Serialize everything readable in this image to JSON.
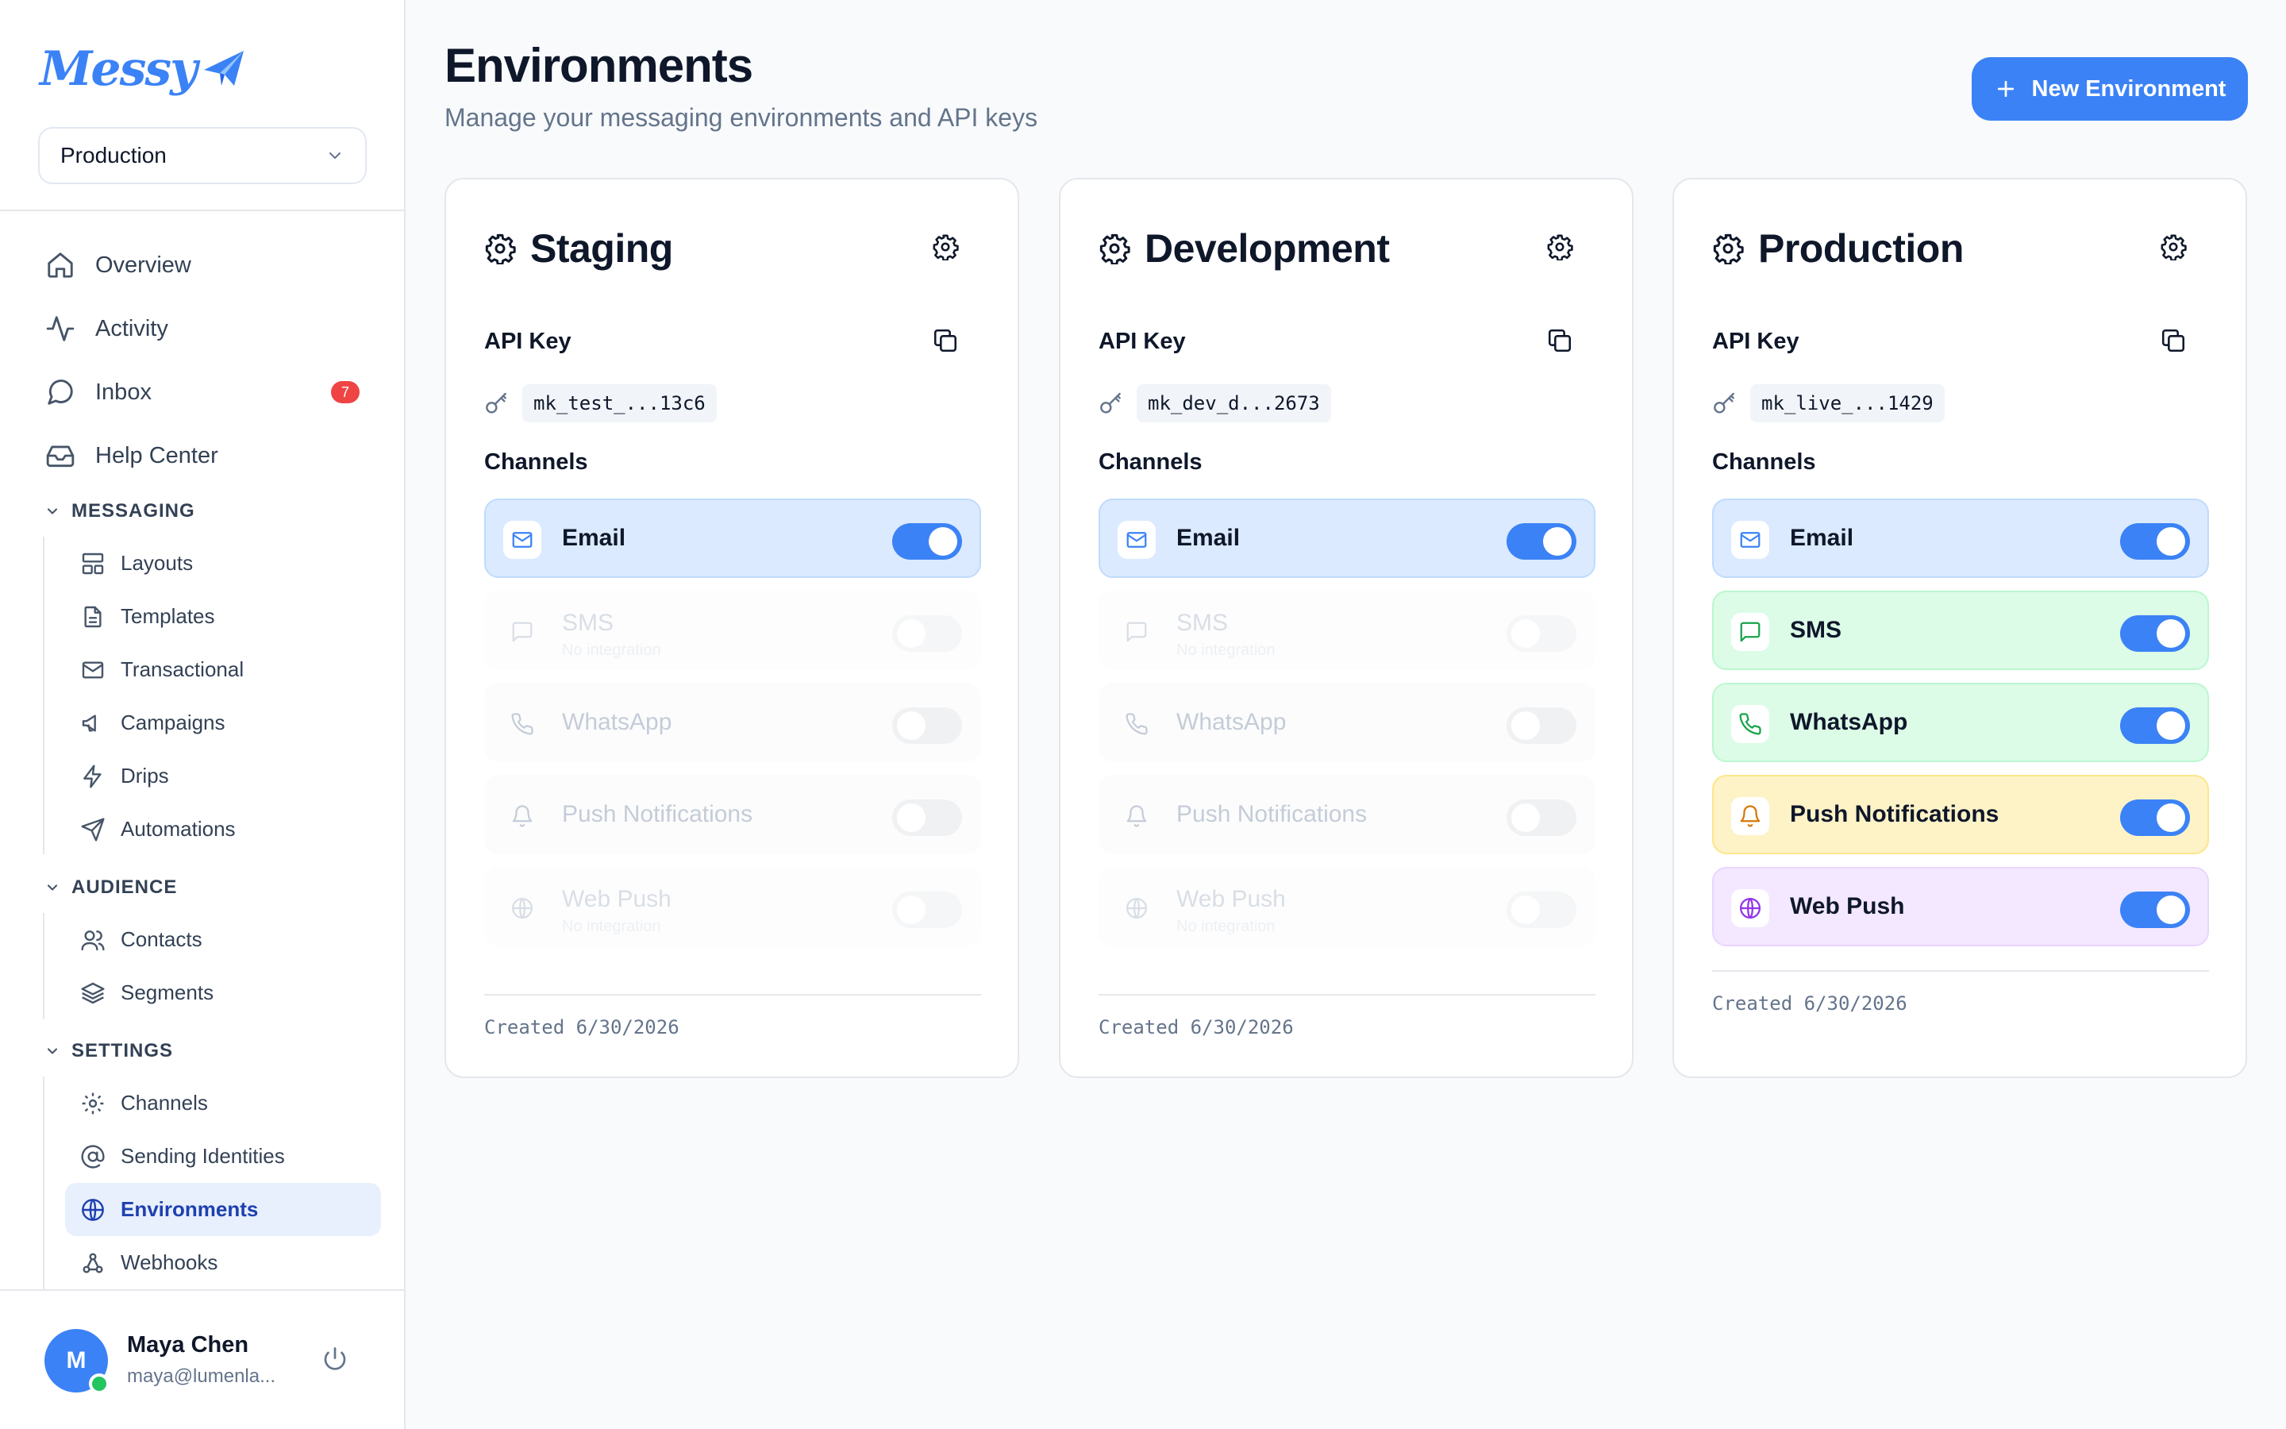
{
  "app": {
    "logo_text": "Messy",
    "brand_color": "#3b82f6"
  },
  "env_select": {
    "value": "Production"
  },
  "nav": {
    "main": [
      {
        "label": "Overview",
        "icon": "home-icon"
      },
      {
        "label": "Activity",
        "icon": "activity-icon"
      },
      {
        "label": "Inbox",
        "icon": "message-icon",
        "badge": "7"
      },
      {
        "label": "Help Center",
        "icon": "inbox-tray-icon"
      }
    ],
    "messaging": {
      "title": "MESSAGING",
      "items": [
        {
          "label": "Layouts",
          "icon": "layout-icon"
        },
        {
          "label": "Templates",
          "icon": "file-icon"
        },
        {
          "label": "Transactional",
          "icon": "mail-icon"
        },
        {
          "label": "Campaigns",
          "icon": "megaphone-icon"
        },
        {
          "label": "Drips",
          "icon": "zap-icon"
        },
        {
          "label": "Automations",
          "icon": "send-icon"
        }
      ]
    },
    "audience": {
      "title": "AUDIENCE",
      "items": [
        {
          "label": "Contacts",
          "icon": "users-icon"
        },
        {
          "label": "Segments",
          "icon": "layers-icon"
        }
      ]
    },
    "settings": {
      "title": "SETTINGS",
      "items": [
        {
          "label": "Channels",
          "icon": "gear-icon"
        },
        {
          "label": "Sending Identities",
          "icon": "at-sign-icon"
        },
        {
          "label": "Environments",
          "icon": "globe-icon",
          "active": true
        },
        {
          "label": "Webhooks",
          "icon": "webhook-icon"
        }
      ]
    }
  },
  "user": {
    "initial": "M",
    "name": "Maya Chen",
    "email": "maya@lumenla...",
    "status_color": "#22c55e"
  },
  "header": {
    "title": "Environments",
    "subtitle": "Manage your messaging environments and API keys",
    "new_button": "New Environment"
  },
  "environments": [
    {
      "name": "Staging",
      "api_key_label": "API Key",
      "api_key": "mk_test_...13c6",
      "channels_label": "Channels",
      "channels": [
        {
          "name": "Email",
          "enabled": true
        },
        {
          "name": "SMS",
          "enabled": false,
          "note": "No integration"
        },
        {
          "name": "WhatsApp",
          "enabled": false
        },
        {
          "name": "Push Notifications",
          "enabled": false
        },
        {
          "name": "Web Push",
          "enabled": false,
          "note": "No integration"
        }
      ],
      "created": "Created 6/30/2026"
    },
    {
      "name": "Development",
      "api_key_label": "API Key",
      "api_key": "mk_dev_d...2673",
      "channels_label": "Channels",
      "channels": [
        {
          "name": "Email",
          "enabled": true
        },
        {
          "name": "SMS",
          "enabled": false,
          "note": "No integration"
        },
        {
          "name": "WhatsApp",
          "enabled": false
        },
        {
          "name": "Push Notifications",
          "enabled": false
        },
        {
          "name": "Web Push",
          "enabled": false,
          "note": "No integration"
        }
      ],
      "created": "Created 6/30/2026"
    },
    {
      "name": "Production",
      "api_key_label": "API Key",
      "api_key": "mk_live_...1429",
      "channels_label": "Channels",
      "channels": [
        {
          "name": "Email",
          "enabled": true
        },
        {
          "name": "SMS",
          "enabled": true
        },
        {
          "name": "WhatsApp",
          "enabled": true
        },
        {
          "name": "Push Notifications",
          "enabled": true
        },
        {
          "name": "Web Push",
          "enabled": true
        }
      ],
      "created": "Created 6/30/2026"
    }
  ]
}
